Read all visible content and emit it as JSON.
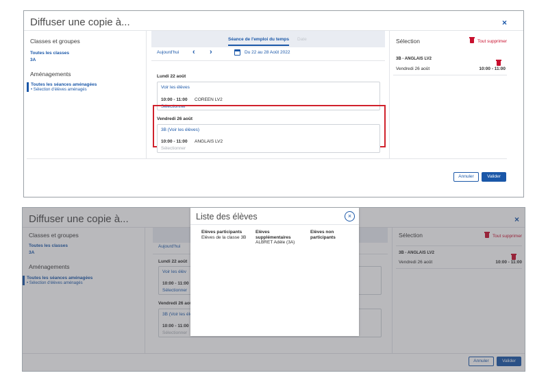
{
  "dialog": {
    "title": "Diffuser une copie à...",
    "close_label": "×"
  },
  "left": {
    "classes_heading": "Classes et groupes",
    "all_classes": "Toutes les classes",
    "class_3a": "3A",
    "amenagements_heading": "Aménagements",
    "all_sessions": "Toutes les séances aménagées",
    "select_students": "• Sélection d'élèves aménagés"
  },
  "middle": {
    "tab_active": "Séance de l'emploi du temps",
    "tab_inactive": "Date",
    "today": "Aujourd'hui",
    "prev_arrow": "‹",
    "next_arrow": "›",
    "date_range": "Du 22 au 28 Août 2022",
    "days": [
      {
        "heading": "Lundi 22 août",
        "link": "Voir les élèves",
        "time": "10:00 - 11:00",
        "subject": "COREEN LV2",
        "select": "Sélectionner"
      },
      {
        "heading": "Vendredi 26 août",
        "link": "3B (Voir les élèves)",
        "time": "10:00 - 11:00",
        "subject": "ANGLAIS LV2",
        "select": "Sélectionner"
      }
    ]
  },
  "panel2_middle": {
    "today": "Aujourd'hui",
    "days": [
      {
        "heading": "Lundi 22 août",
        "link": "Voir les élèv",
        "time": "10:00 - 11:00",
        "select": "Sélectionner"
      },
      {
        "heading": "Vendredi 26 aoû",
        "link": "3B (Voir les élè",
        "time": "10:00 - 11:00",
        "select": "Sélectionner"
      }
    ]
  },
  "selection": {
    "title": "Sélection",
    "clear_all": "Tout supprimer",
    "item": {
      "title": "3B - ANGLAIS LV2",
      "date": "Vendredi 26 août",
      "time": "10:00 - 11:00"
    }
  },
  "panel2_selection": {
    "clear_all": "Tout supprimer"
  },
  "footer": {
    "cancel": "Annuler",
    "ok": "Valider"
  },
  "modal": {
    "title": "Liste des élèves",
    "close_label": "×",
    "col1_head": "Elèves participants",
    "col1_value": "Elèves de la classe 3B",
    "col2_head": "Elèves supplémentaires",
    "col2_value": "ALBRET Adèle (3A)",
    "col3_head": "Elèves non participants"
  },
  "colors": {
    "primary": "#1a57a8",
    "danger": "#c8102e",
    "highlight_frame": "#d0212b"
  }
}
